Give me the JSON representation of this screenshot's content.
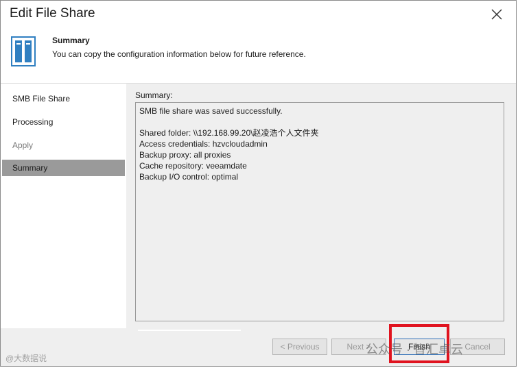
{
  "window": {
    "title": "Edit File Share"
  },
  "header": {
    "title": "Summary",
    "subtitle": "You can copy the configuration information below for future reference.",
    "icon": "file-share-icon"
  },
  "sidebar": {
    "items": [
      {
        "label": "SMB File Share",
        "state": "normal"
      },
      {
        "label": "Processing",
        "state": "normal"
      },
      {
        "label": "Apply",
        "state": "disabled"
      },
      {
        "label": "Summary",
        "state": "active"
      }
    ]
  },
  "summary": {
    "label": "Summary:",
    "lines": [
      "SMB file share was saved successfully.",
      "",
      "Shared folder: \\\\192.168.99.20\\赵凌浩个人文件夹",
      "Access credentials: hzvcloudadmin",
      "Backup proxy: all proxies",
      "Cache repository: veeamdate",
      "Backup I/O control: optimal"
    ]
  },
  "footer": {
    "previous_label": "< Previous",
    "next_label": "Next >",
    "finish_label": "Finish",
    "cancel_label": "Cancel"
  },
  "watermarks": {
    "wechat_text": "公众号 · 智汇卓云",
    "corner_text": "@大数据说"
  },
  "colors": {
    "highlight_border": "#e0131f",
    "active_step_bg": "#9a9a9a",
    "icon_blue": "#2f7fc1",
    "finish_border": "#2f6fb8"
  }
}
